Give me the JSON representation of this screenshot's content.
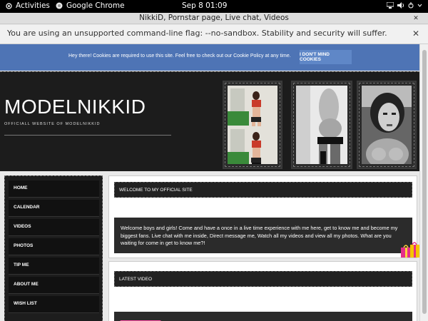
{
  "system_bar": {
    "activities": "Activities",
    "app_name": "Google Chrome",
    "clock": "Sep 8  01:09"
  },
  "browser": {
    "window_title": "NikkiD, Pornstar page, Live chat, Videos",
    "infobar_message": "You are using an unsupported command-line flag: --no-sandbox. Stability and security will suffer."
  },
  "cookie_banner": {
    "text": "Hey there! Cookies are required to use this site. Feel free to check out our Cookie Policy at any time.",
    "button": "I DON'T MIND COOKIES"
  },
  "header": {
    "site_name": "MODELNIKKID",
    "tagline": "OFFICIALL WEBSITE OF MODELNIKKID"
  },
  "menu": [
    {
      "label": "HOME"
    },
    {
      "label": "CALENDAR"
    },
    {
      "label": "VIDEOS"
    },
    {
      "label": "PHOTOS"
    },
    {
      "label": "TIP ME"
    },
    {
      "label": "ABOUT ME"
    },
    {
      "label": "WISH LIST"
    }
  ],
  "main": {
    "welcome_heading": "WELCOME TO MY OFFICIAL SITE",
    "welcome_text": "Welcome boys and girls! Come and have a once in a live time experience with me here, get to know me and become my biggest fans. Live chat with me inside, Direct message me, Watch all my videos and view all my photos. What are you waiting for come in get to know me?!",
    "latest_video_heading": "LATEST VIDEO"
  },
  "colors": {
    "cookie_bg": "#4e74b5",
    "header_bg": "#1c1c1c",
    "accent_pink": "#ff4fa6"
  }
}
